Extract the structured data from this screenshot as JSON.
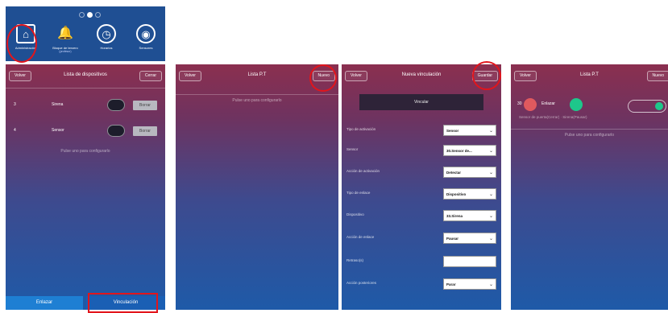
{
  "topnav": {
    "items": [
      {
        "label": "Administración",
        "sub": "",
        "icon": "home-icon",
        "glyph": "⌂"
      },
      {
        "label": "Bloque de tercero",
        "sub": "(profesor)",
        "icon": "bell-icon",
        "glyph": "🔔"
      },
      {
        "label": "Horarios",
        "sub": "",
        "icon": "clock-icon",
        "glyph": "◷"
      },
      {
        "label": "Sensores",
        "sub": "",
        "icon": "sensor-icon",
        "glyph": "◉"
      }
    ]
  },
  "screen1": {
    "back": "Volver",
    "title": "Lista de dispositivos",
    "action": "Cerrar",
    "rows": [
      {
        "num": "3",
        "name": "Sirena",
        "delete": "Borrar"
      },
      {
        "num": "4",
        "name": "Sensor",
        "delete": "Borrar"
      }
    ],
    "hint": "Pulse uno para configurarlo",
    "tabs": [
      "Enlazar",
      "Vinculación"
    ]
  },
  "screen2": {
    "back": "Volver",
    "title": "Lista P.T",
    "action": "Nuevo",
    "hint": "Pulse uno para configurarlo"
  },
  "screen3": {
    "back": "Volver",
    "title": "Nueva vinculación",
    "action": "Guardar",
    "button": "Vincular",
    "rows": [
      {
        "label": "Tipo de activación",
        "value": "Sensor"
      },
      {
        "label": "Sensor",
        "value": "30.Sensor de..."
      },
      {
        "label": "Acción de activación",
        "value": "Detectar"
      },
      {
        "label": "Tipo de enlace",
        "value": "Dispositivo"
      },
      {
        "label": "Dispositivo",
        "value": "33.Sirena"
      },
      {
        "label": "Acción de enlace",
        "value": "Pausar"
      },
      {
        "label": "Retraso(s)",
        "value": ""
      },
      {
        "label": "Acción posteriores",
        "value": "Parar"
      }
    ]
  },
  "screen4": {
    "back": "Volver",
    "title": "Lista P.T",
    "action": "Nuevo",
    "item_num": "30",
    "item_link": "Enlazar",
    "item_desc": "Sensor de puerta(Cerrar) · Sirena(Pausar)",
    "hint": "Pulse uno para configurarlo"
  },
  "colors": {
    "highlight": "#e2151c",
    "accent_green": "#1ec78b",
    "accent_red": "#e0595e",
    "nav_bg": "#1f4f93"
  }
}
